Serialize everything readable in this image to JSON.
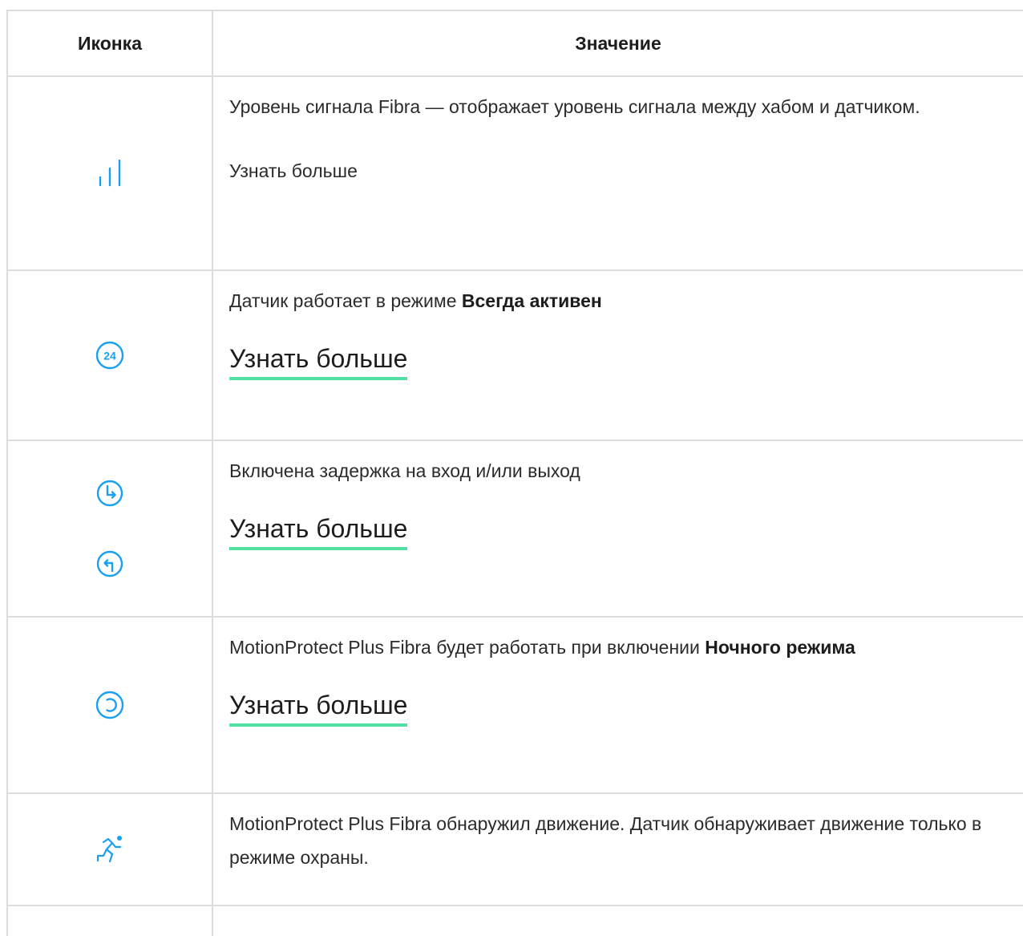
{
  "table": {
    "headers": {
      "icon": "Иконка",
      "meaning": "Значение"
    },
    "rows": [
      {
        "icons": [
          "signal-strength-icon"
        ],
        "text": "Уровень сигнала Fibra — отображает уровень сигнала между хабом и датчиком.",
        "more": "Узнать больше"
      },
      {
        "icons": [
          "always-active-24-icon"
        ],
        "text_before": "Датчик работает в режиме ",
        "text_bold": "Всегда активен",
        "icon_label": "24",
        "more": "Узнать больше"
      },
      {
        "icons": [
          "entry-delay-icon",
          "exit-delay-icon"
        ],
        "text": "Включена задержка на вход и/или выход",
        "more": "Узнать больше"
      },
      {
        "icons": [
          "night-mode-icon"
        ],
        "text_before": "MotionProtect Plus Fibra будет работать при включении ",
        "text_bold": "Ночного режима",
        "more": "Узнать больше"
      },
      {
        "icons": [
          "motion-detected-icon"
        ],
        "text": "MotionProtect Plus Fibra обнаружил движение. Датчик обнаруживает движение только в режиме охраны."
      }
    ]
  },
  "colors": {
    "icon_blue": "#1aa0f0",
    "link_underline": "#52dfa0",
    "border": "#dcdcdc"
  }
}
